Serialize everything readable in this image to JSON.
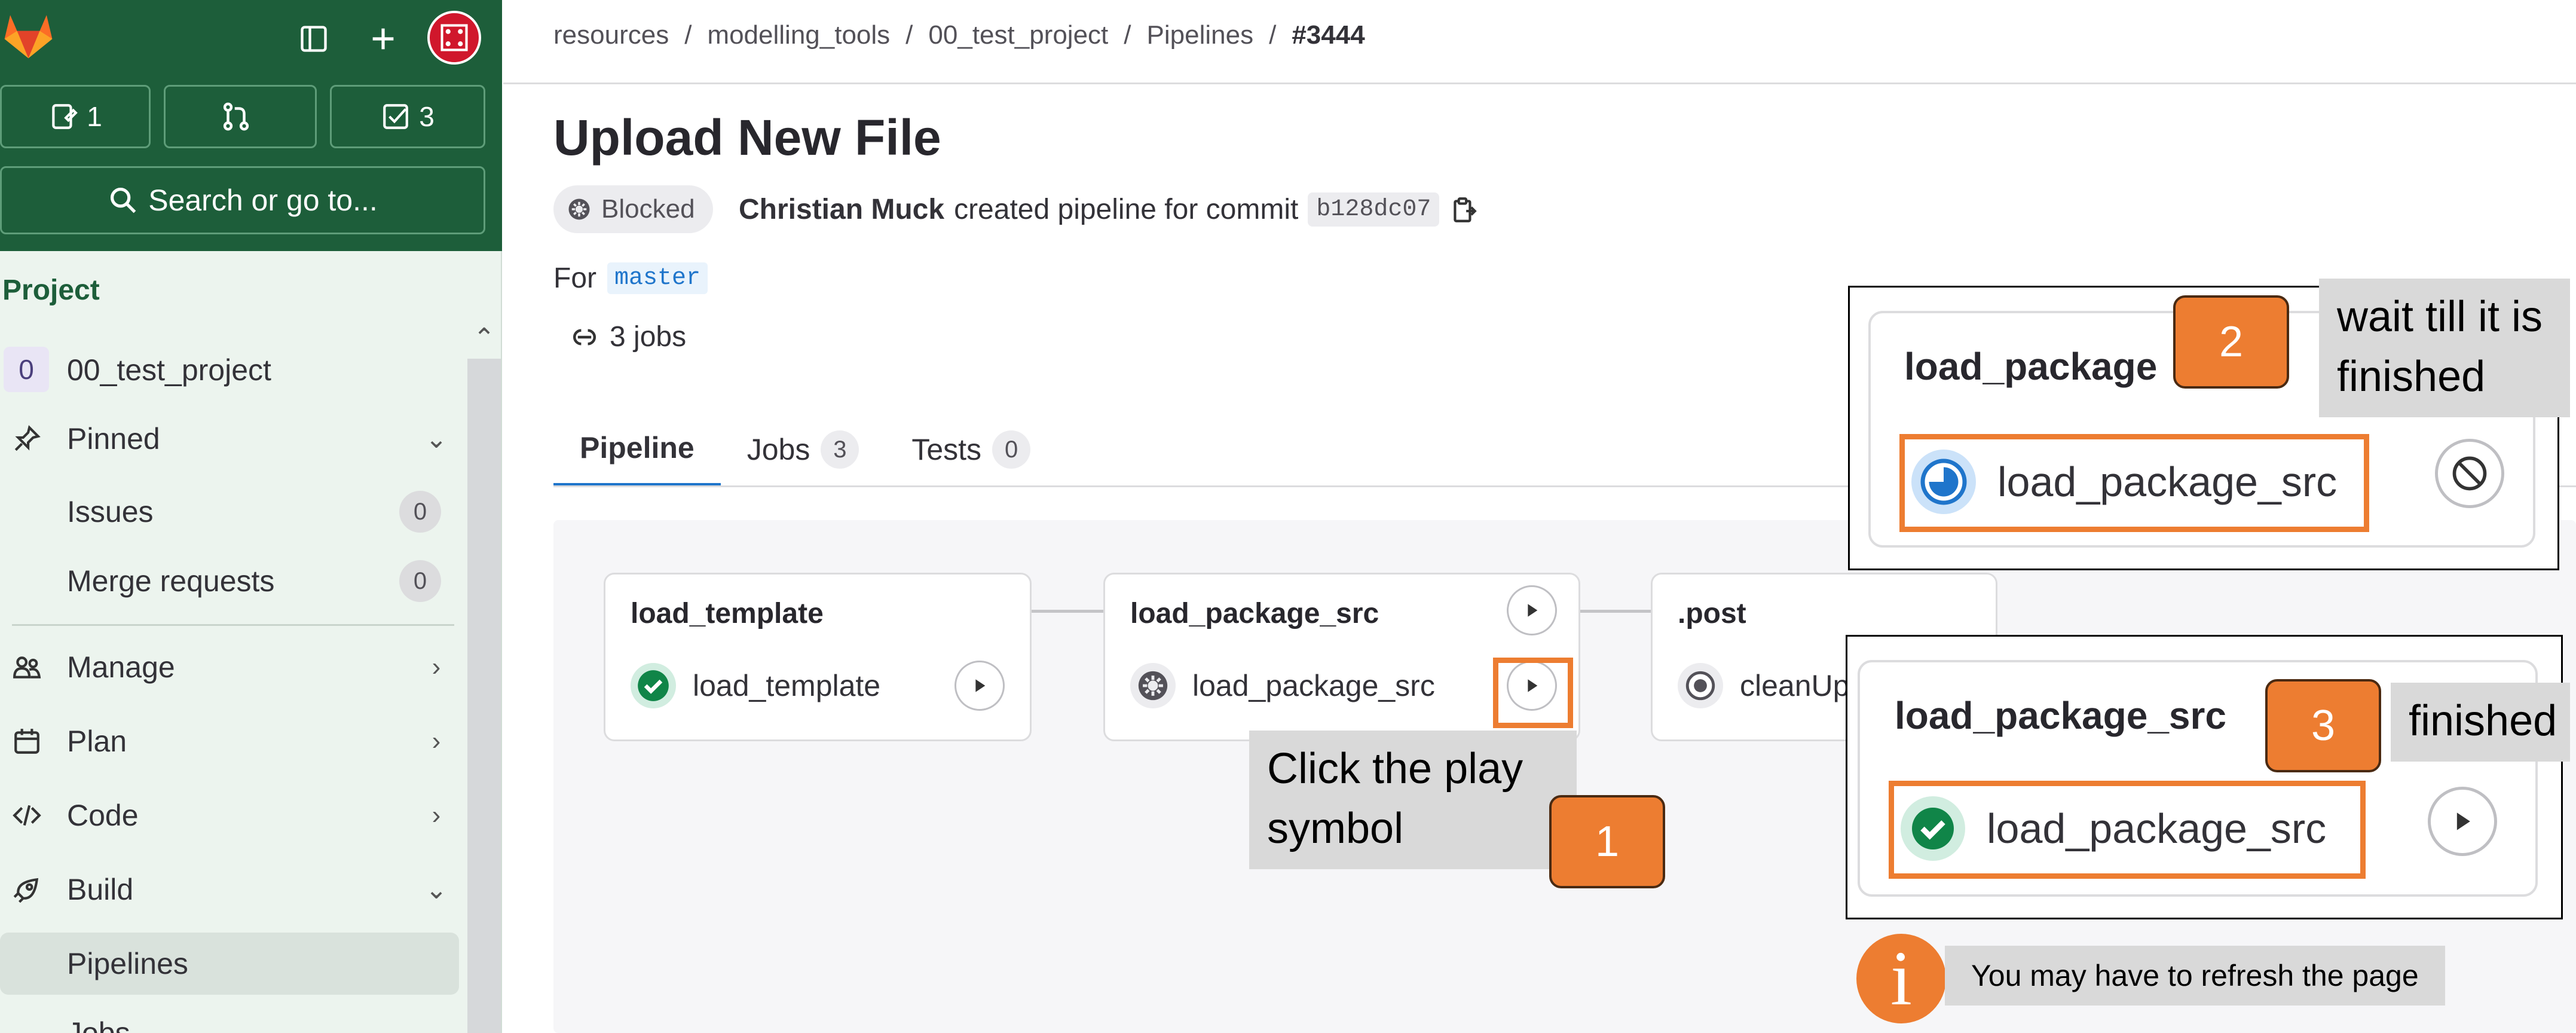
{
  "sidebar": {
    "counters": [
      {
        "name": "issues-counter",
        "value": "1"
      },
      {
        "name": "merge-requests-counter",
        "value": ""
      },
      {
        "name": "todos-counter",
        "value": "3"
      }
    ],
    "search_label": "Search or go to...",
    "section_heading": "Project",
    "project": {
      "avatar_letter": "0",
      "name": "00_test_project"
    },
    "items": {
      "pinned": "Pinned",
      "issues": "Issues",
      "issues_count": "0",
      "merge_requests": "Merge requests",
      "merge_requests_count": "0",
      "manage": "Manage",
      "plan": "Plan",
      "code": "Code",
      "build": "Build",
      "pipelines": "Pipelines",
      "jobs": "Jobs"
    }
  },
  "breadcrumb": [
    "resources",
    "/",
    "modelling_tools",
    "/",
    "00_test_project",
    "/",
    "Pipelines",
    "/",
    "#3444"
  ],
  "pipeline": {
    "title": "Upload New File",
    "status": "Blocked",
    "author": "Christian Muck",
    "created_text": "created pipeline for commit",
    "commit": "b128dc07",
    "for_label": "For",
    "branch": "master",
    "jobs_summary": "3 jobs"
  },
  "tabs": [
    {
      "label": "Pipeline",
      "count": ""
    },
    {
      "label": "Jobs",
      "count": "3"
    },
    {
      "label": "Tests",
      "count": "0"
    }
  ],
  "stages": [
    {
      "title": "load_template",
      "job": "load_template",
      "status": "success"
    },
    {
      "title": "load_package_src",
      "job": "load_package_src",
      "status": "manual"
    },
    {
      "title": ".post",
      "job": "cleanUp",
      "status": "created"
    }
  ],
  "annotations": {
    "step1_text": "Click the play symbol",
    "step1_number": "1",
    "step2_text": "wait till it is finished",
    "step2_number": "2",
    "step2_card_title": "load_package",
    "step2_job": "load_package_src",
    "step3_text": "finished",
    "step3_number": "3",
    "step3_card_title": "load_package_src",
    "step3_job": "load_package_src",
    "info_symbol": "i",
    "info_text": "You may have to refresh the page"
  },
  "colors": {
    "sidebar_top": "#1d5e3a",
    "accent_orange": "#ed7d31",
    "success_green": "#108548",
    "link_blue": "#1f75cb",
    "running_blue": "#1f75cb"
  }
}
